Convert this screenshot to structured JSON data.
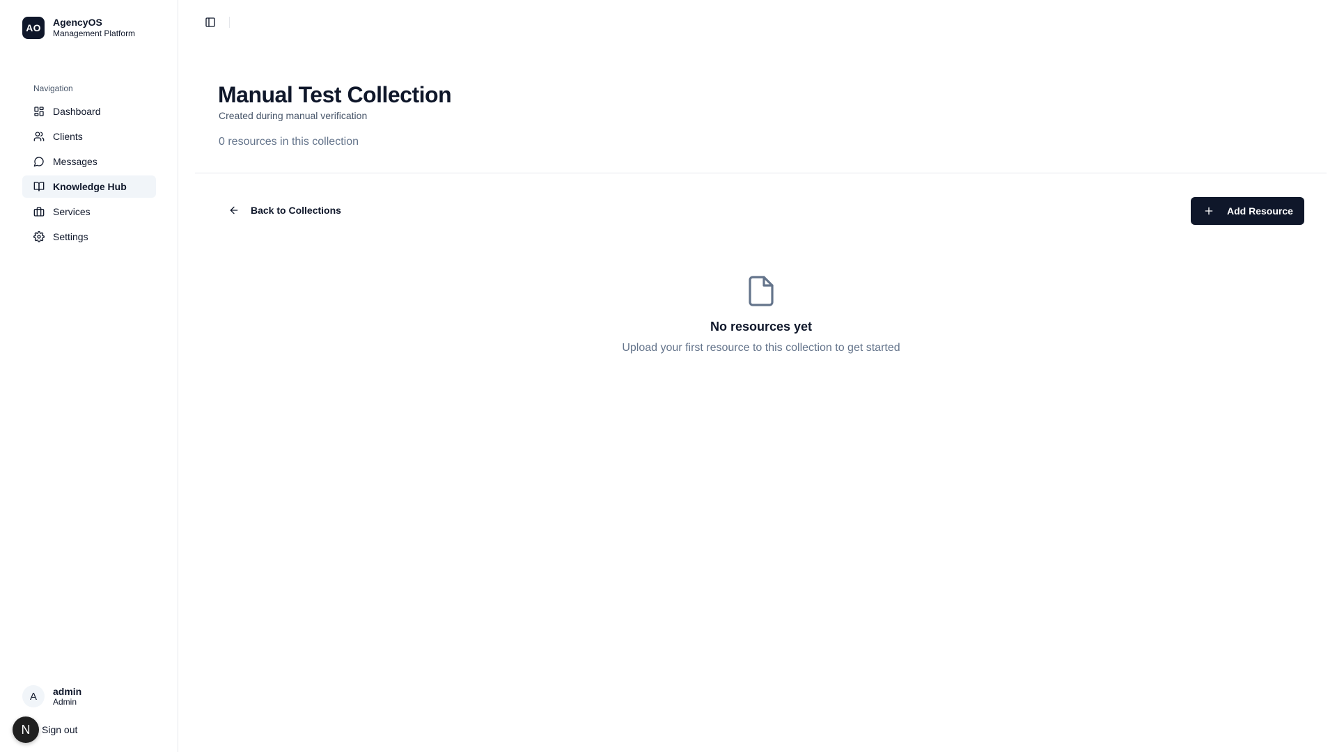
{
  "brand": {
    "logo": "AO",
    "name": "AgencyOS",
    "subtitle": "Management Platform"
  },
  "sidebar": {
    "heading": "Navigation",
    "items": [
      {
        "label": "Dashboard",
        "icon": "dashboard-icon",
        "active": false
      },
      {
        "label": "Clients",
        "icon": "users-icon",
        "active": false
      },
      {
        "label": "Messages",
        "icon": "message-circle-icon",
        "active": false
      },
      {
        "label": "Knowledge Hub",
        "icon": "book-open-icon",
        "active": true
      },
      {
        "label": "Services",
        "icon": "briefcase-icon",
        "active": false
      },
      {
        "label": "Settings",
        "icon": "gear-icon",
        "active": false
      }
    ]
  },
  "user": {
    "initial": "A",
    "name": "admin",
    "role": "Admin",
    "signout_label": "Sign out"
  },
  "dev_badge": {
    "letter": "N"
  },
  "page": {
    "title": "Manual Test Collection",
    "description": "Created during manual verification",
    "count_text": "0 resources in this collection"
  },
  "actions": {
    "back_label": "Back to Collections",
    "add_label": "Add Resource"
  },
  "empty_state": {
    "icon": "file-icon",
    "title": "No resources yet",
    "subtitle": "Upload your first resource to this collection to get started"
  },
  "colors": {
    "primary": "#0f172a",
    "muted_text": "#64748b",
    "active_bg": "#f1f5f9",
    "border": "#e5e7eb"
  }
}
